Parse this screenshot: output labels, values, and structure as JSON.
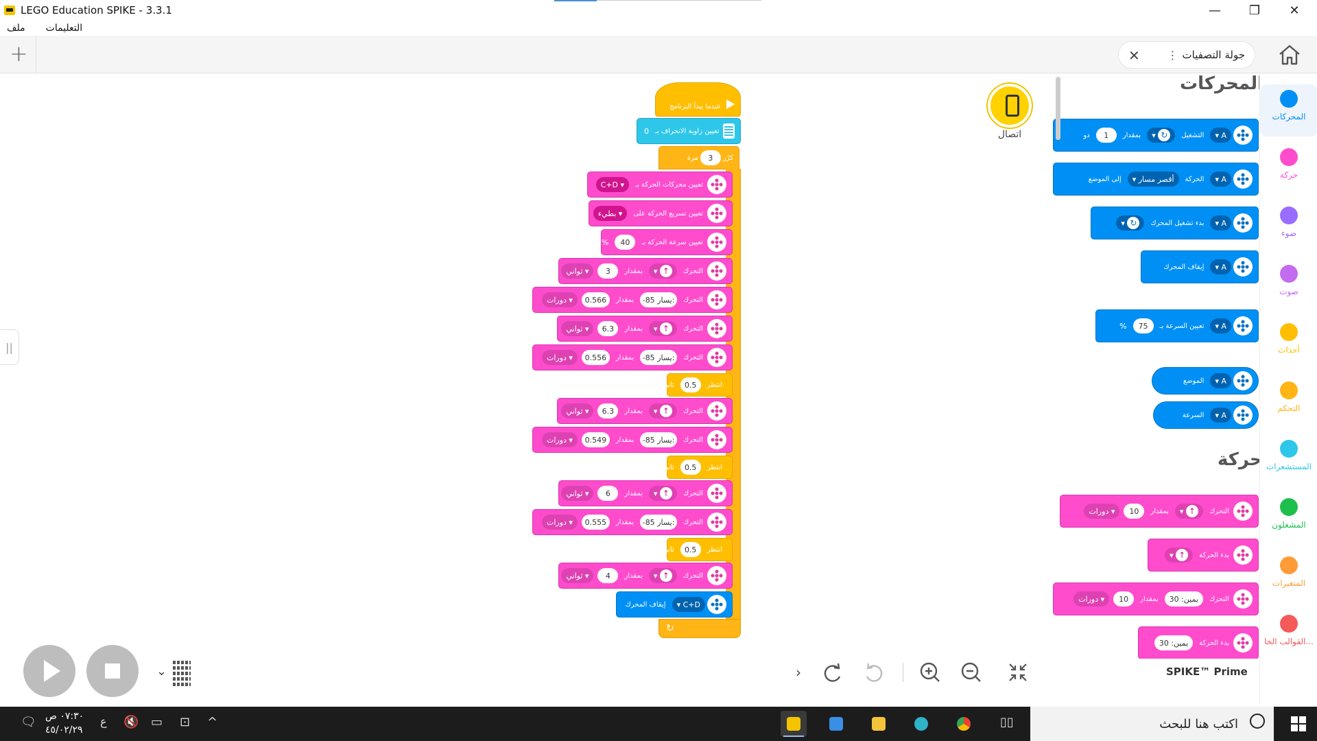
{
  "window": {
    "title": "LEGO Education SPIKE - 3.3.1",
    "minimize": "—",
    "restore": "❐",
    "close": "✕"
  },
  "menu": {
    "file": "ملف",
    "tutorials": "التعليمات"
  },
  "tab": {
    "name": "جولة التصفيات",
    "dots": "⋮",
    "close": "✕",
    "plus": "+"
  },
  "connect": {
    "label": "اتصال"
  },
  "program": {
    "hat": "عندما يبدأ البرنامج",
    "set_yaw": {
      "text": "تعيين زاوية الانحراف بـ",
      "value": "0"
    },
    "repeat": {
      "text": "كرّر",
      "count": "3",
      "unit": "مرة"
    },
    "b1": {
      "text": "تعيين محركات الحركة بـ",
      "port": "C+D"
    },
    "b2": {
      "text": "تعيين تسريع الحركة على",
      "value": "بطيء"
    },
    "b3": {
      "text": "تعيين سرعة الحركة بـ",
      "value": "40",
      "unit": "%"
    },
    "move_label": "التحرك",
    "by": "بمقدار",
    "seconds": "ثواني",
    "rotations": "دورات",
    "left": "يسار:",
    "wait": "انتظر",
    "sec": "ثانية",
    "m1": {
      "amount": "3"
    },
    "t1": {
      "steer": "-85",
      "amount": "0.566"
    },
    "m2": {
      "amount": "6.3"
    },
    "t2": {
      "steer": "-85",
      "amount": "0.556"
    },
    "w1": {
      "value": "0.5"
    },
    "m3": {
      "amount": "6.3"
    },
    "t3": {
      "steer": "-85",
      "amount": "0.549"
    },
    "w2": {
      "value": "0.5"
    },
    "m4": {
      "amount": "6"
    },
    "t4": {
      "steer": "-85",
      "amount": "0.555"
    },
    "w3": {
      "value": "0.5"
    },
    "m5": {
      "amount": "4"
    },
    "stop": {
      "text": "إيقاف المحرك",
      "port": "C+D"
    },
    "loop_arrow": "↻"
  },
  "palette": {
    "heading_motors": "المحركات",
    "heading_move": "حركة",
    "p1": {
      "port": "A",
      "run": "التشغيل",
      "by": "بمقدار",
      "amount": "1",
      "suffix": "دو"
    },
    "p2": {
      "port": "A",
      "text": "الحركة",
      "path": "أقصر مسار",
      "to": "إلى الموضع"
    },
    "p3": {
      "port": "A",
      "text": "بدء تشغيل المحرك"
    },
    "p4": {
      "port": "A",
      "text": "إيقاف المحرك"
    },
    "p5": {
      "port": "A",
      "text": "تعيين السرعة بـ",
      "value": "75",
      "unit": "%"
    },
    "p6": {
      "port": "A",
      "text": "الموضع"
    },
    "p7": {
      "port": "A",
      "text": "السرعة"
    },
    "q1": {
      "text": "التحرك",
      "by": "بمقدار",
      "amount": "10",
      "unit": "دورات"
    },
    "q2": {
      "text": "بدء الحركة"
    },
    "q3": {
      "text": "التحرك",
      "steer": "يمين: 30",
      "by": "بمقدار",
      "amount": "10",
      "unit": "دورات"
    },
    "q4": {
      "text": "بدء الحركة",
      "steer": "يمين: 30"
    },
    "hub": "SPIKE™ Prime",
    "hub_dots": "⋮"
  },
  "categories": [
    {
      "label": "المحركات",
      "color": "#0090f5"
    },
    {
      "label": "حركة",
      "color": "#ff4ccd"
    },
    {
      "label": "ضوء",
      "color": "#9a6cff"
    },
    {
      "label": "صوت",
      "color": "#c46cf0"
    },
    {
      "label": "أحداث",
      "color": "#ffbf00"
    },
    {
      "label": "التحكم",
      "color": "#ffb515"
    },
    {
      "label": "المستشعرات",
      "color": "#2ec7e9"
    },
    {
      "label": "المشغلون",
      "color": "#1fbf4d"
    },
    {
      "label": "المتغيرات",
      "color": "#ff9c37"
    },
    {
      "label": "القوالب الخا...",
      "color": "#f55a5a"
    }
  ],
  "taskbar": {
    "search": "اكتب هنا للبحث",
    "time": "٠٧:٣٠ ص",
    "date": "٤٥/٠٢/٢٩",
    "lang": "ع"
  }
}
